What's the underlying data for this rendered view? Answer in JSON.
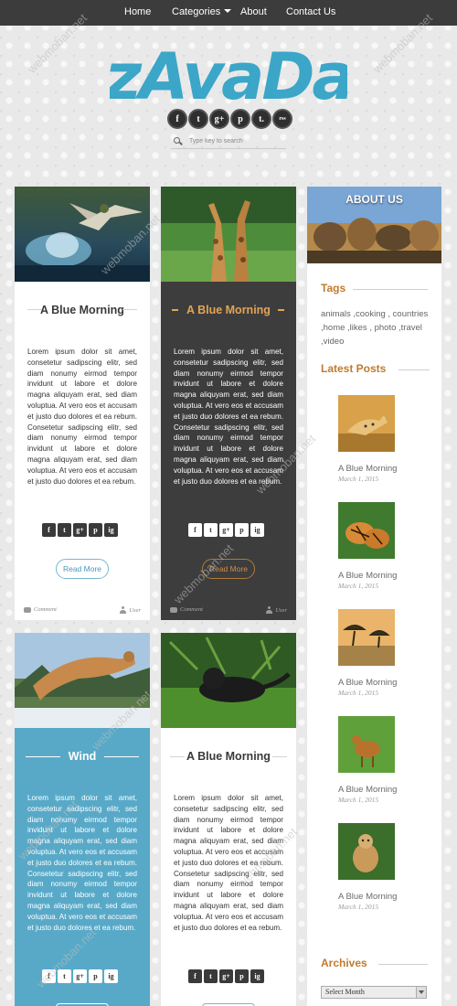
{
  "nav": {
    "home": "Home",
    "categories": "Categories",
    "about": "About",
    "contact": "Contact Us"
  },
  "logo_text": "zAvaDa",
  "header_social": [
    "f",
    "t",
    "g+",
    "p",
    "t.",
    "rss"
  ],
  "search": {
    "placeholder": "Type key to search"
  },
  "posts": [
    {
      "title": "A Blue Morning",
      "body": "Lorem ipsum dolor sit amet, consetetur sadipscing elitr, sed diam nonumy eirmod tempor invidunt ut labore et dolore magna aliquyam erat, sed diam voluptua. At vero eos et accusam et justo duo dolores et ea rebum. Consetetur sadipscing elitr, sed diam nonumy eirmod tempor invidunt ut labore et dolore magna aliquyam erat, sed diam voluptua. At vero eos et accusam et justo duo dolores et ea rebum.",
      "read_more": "Read More",
      "comment": "Comment",
      "user": "User"
    },
    {
      "title": "A Blue Morning",
      "body": "Lorem ipsum dolor sit amet, consetetur sadipscing elitr, sed diam nonumy eirmod tempor invidunt ut labore et dolore magna aliquyam erat, sed diam voluptua. At vero eos et accusam et justo duo dolores et ea rebum. Consetetur sadipscing elitr, sed diam nonumy eirmod tempor invidunt ut labore et dolore magna aliquyam erat, sed diam voluptua. At vero eos et accusam et justo duo dolores et ea rebum.",
      "read_more": "Read More",
      "comment": "Comment",
      "user": "User"
    },
    {
      "title": "Wind",
      "body": "Lorem ipsum dolor sit amet, consetetur sadipscing elitr, sed diam nonumy eirmod tempor invidunt ut labore et dolore magna aliquyam erat, sed diam voluptua. At vero eos et accusam et justo duo dolores et ea rebum. Consetetur sadipscing elitr, sed diam nonumy eirmod tempor invidunt ut labore et dolore magna aliquyam erat, sed diam voluptua. At vero eos et accusam et justo duo dolores et ea rebum.",
      "read_more": "Read More"
    },
    {
      "title": "A Blue Morning",
      "body": "Lorem ipsum dolor sit amet, consetetur sadipscing elitr, sed diam nonumy eirmod tempor invidunt ut labore et dolore magna aliquyam erat, sed diam voluptua. At vero eos et accusam et justo duo dolores et ea rebum. Consetetur sadipscing elitr, sed diam nonumy eirmod tempor invidunt ut labore et dolore magna aliquyam erat, sed diam voluptua. At vero eos et accusam et justo duo dolores et ea rebum.",
      "read_more": "Read More"
    }
  ],
  "card_social": [
    "f",
    "t",
    "g+",
    "p",
    "ig"
  ],
  "sidebar": {
    "about_title": "ABOUT US",
    "tags_title": "Tags",
    "tags": "animals ,cooking , countries ,home ,likes , photo ,travel ,video",
    "latest_title": "Latest Posts",
    "latest_posts": [
      {
        "title": "A Blue Morning",
        "date": "March 1, 2015"
      },
      {
        "title": "A Blue Morning",
        "date": "March 1, 2015"
      },
      {
        "title": "A Blue Morning",
        "date": "March 1, 2015"
      },
      {
        "title": "A Blue Morning",
        "date": "March 1, 2015"
      },
      {
        "title": "A Blue Morning",
        "date": "March 1, 2015"
      }
    ],
    "archives_title": "Archives",
    "select_month": "Select Month"
  },
  "watermark": "webmoban.net",
  "colors": {
    "nav_bg": "#3c3c3c",
    "accent_orange": "#c07a2e",
    "accent_blue": "#58a9c8",
    "logo_blue": "#3ba6c8",
    "dark_card": "#3d3d3d"
  }
}
